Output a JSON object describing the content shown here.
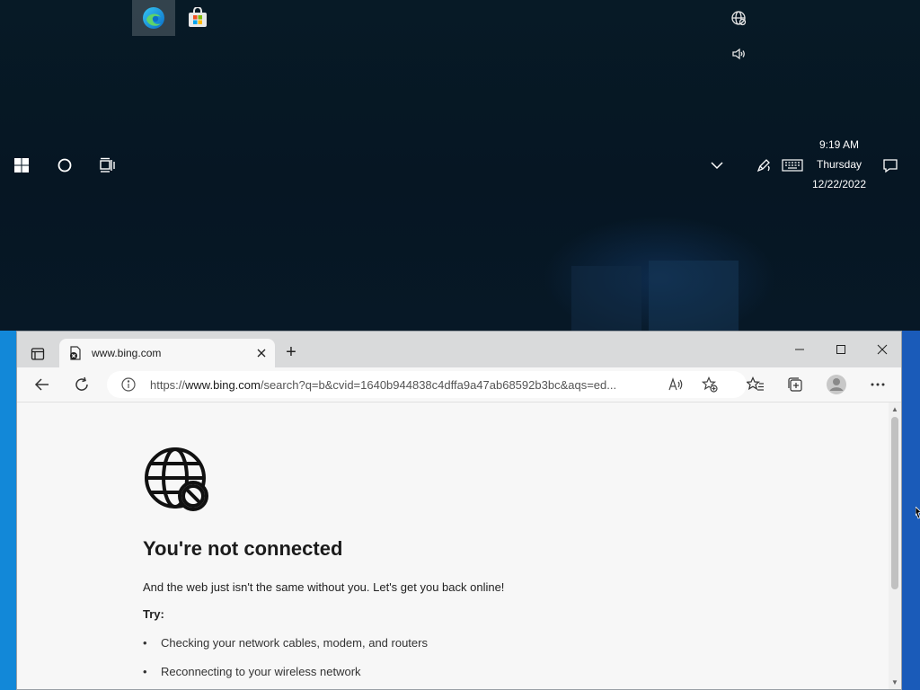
{
  "taskbar": {
    "pinned": [
      "edge-icon",
      "store-icon"
    ],
    "start_icon": "windows-icon",
    "search_icon": "cortana-circle-icon",
    "task_view_icon": "task-view-icon",
    "tray": {
      "network_icon": "globe-icon",
      "volume_icon": "speaker-icon",
      "overflow_icon": "chevron-up-icon",
      "pen_icon": "pen-icon",
      "keyboard_icon": "keyboard-icon",
      "notification_icon": "notification-icon"
    },
    "clock": {
      "time": "9:19 AM",
      "day": "Thursday",
      "date": "12/22/2022"
    }
  },
  "browser": {
    "tab": {
      "title": "www.bing.com",
      "favicon": "offline-page-icon"
    },
    "new_tab_label": "+",
    "window_controls": [
      "minimize",
      "maximize",
      "close"
    ],
    "address": {
      "protocol": "https://",
      "host": "www.bing.com",
      "path": "/search?q=b&cvid=1640b944838c4dffa9a47ab68592b3bc&aqs=ed..."
    },
    "toolbar_icons": [
      "back-icon",
      "refresh-icon",
      "info-icon",
      "read-aloud-icon",
      "add-favorite-icon",
      "favorites-icon",
      "collections-icon",
      "profile-icon",
      "more-icon"
    ]
  },
  "error_page": {
    "icon": "globe-blocked-icon",
    "title": "You're not connected",
    "subtitle": "And the web just isn't the same without you. Let's get you back online!",
    "try_label": "Try:",
    "suggestions": [
      "Checking your network cables, modem, and routers",
      "Reconnecting to your wireless network"
    ]
  },
  "colors": {
    "desktop_bg": "#071a26",
    "taskbar_blue_left": "#1288d8",
    "taskbar_blue_right": "#1a5bb9",
    "page_bg": "#f7f7f7"
  }
}
